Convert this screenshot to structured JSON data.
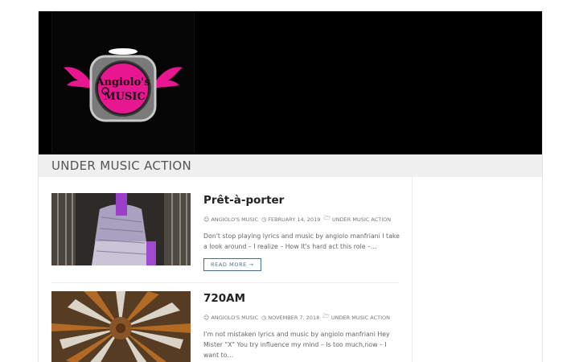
{
  "logo": {
    "alt": "Angiolo's Music logo",
    "line1": "Angiolo's",
    "line2": "MUSIC",
    "accent_color": "#e8168f"
  },
  "category": {
    "title": "UNDER MUSIC ACTION"
  },
  "posts": [
    {
      "title": "Prêt-à-porter",
      "author": "ANGIOLO'S MUSIC",
      "date": "FEBRUARY 14, 2019",
      "category": "UNDER MUSIC ACTION",
      "excerpt": "Don't stop playing lyrics and music by angiolo manfriani I take a look around – I realize – How It's hard act this role –…",
      "read_more": "READ MORE →"
    },
    {
      "title": "720AM",
      "author": "ANGIOLO'S MUSIC",
      "date": "NOVEMBER 7, 2018",
      "category": "UNDER MUSIC ACTION",
      "excerpt": "I'm not mistaken lyrics and music by angiolo manfriani Hey Mister \"X\" You try influence my mind – Is too much,now – I want to…"
    }
  ],
  "icons": {
    "author": "user-icon",
    "date": "clock-icon",
    "category": "folder-icon"
  }
}
